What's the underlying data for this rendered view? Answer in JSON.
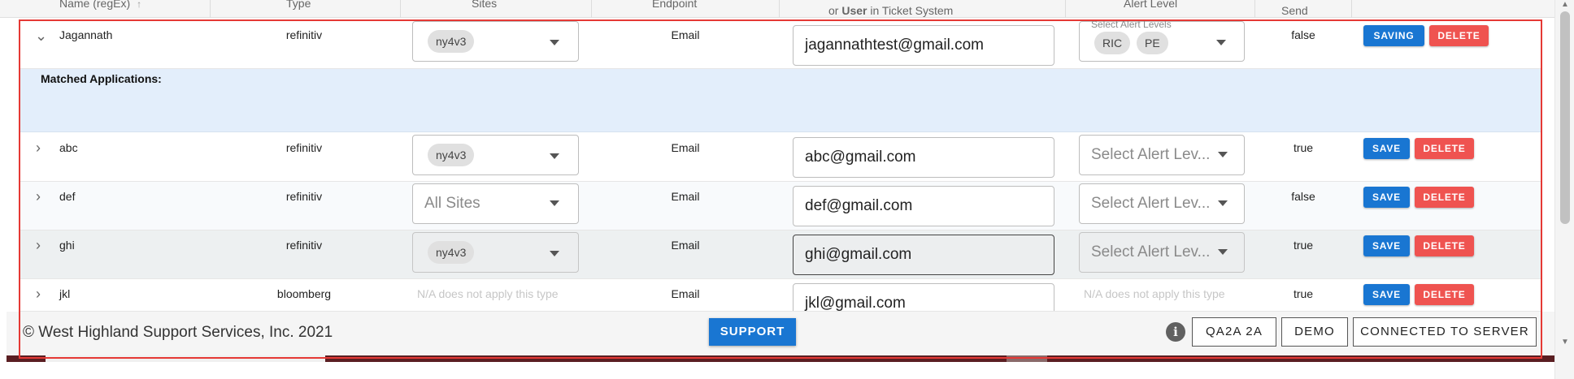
{
  "header": {
    "col_name": "Name (regEx)",
    "col_type": "Type",
    "col_sites": "Sites",
    "col_endpoint": "Endpoint",
    "col_email_line2_prefix": "or",
    "col_email_line2_bold": "User",
    "col_email_line2_suffix": "in Ticket System",
    "col_alert": "Alert Level",
    "col_send": "Send"
  },
  "rows": [
    {
      "name": "Jagannath",
      "type": "refinitiv",
      "site_chip": "ny4v3",
      "endpoint": "Email",
      "email": "jagannathtest@gmail.com",
      "alert_label": "Select Alert Levels",
      "alert_chips": [
        "RIC",
        "PE"
      ],
      "send": "false",
      "save_label": "SAVING",
      "delete_label": "DELETE"
    },
    {
      "name": "abc",
      "type": "refinitiv",
      "site_chip": "ny4v3",
      "endpoint": "Email",
      "email": "abc@gmail.com",
      "alert_placeholder": "Select Alert Lev...",
      "send": "true",
      "save_label": "SAVE",
      "delete_label": "DELETE"
    },
    {
      "name": "def",
      "type": "refinitiv",
      "sites_placeholder": "All Sites",
      "endpoint": "Email",
      "email": "def@gmail.com",
      "alert_placeholder": "Select Alert Lev...",
      "send": "false",
      "save_label": "SAVE",
      "delete_label": "DELETE"
    },
    {
      "name": "ghi",
      "type": "refinitiv",
      "site_chip": "ny4v3",
      "endpoint": "Email",
      "email": "ghi@gmail.com",
      "alert_placeholder": "Select Alert Lev...",
      "send": "true",
      "save_label": "SAVE",
      "delete_label": "DELETE"
    },
    {
      "name": "jkl",
      "type": "bloomberg",
      "sites_na": "N/A does not apply this type",
      "endpoint": "Email",
      "email": "jkl@gmail.com",
      "alert_na": "N/A does not apply this type",
      "send": "true",
      "save_label": "SAVE",
      "delete_label": "DELETE"
    }
  ],
  "matched": {
    "label": "Matched Applications:"
  },
  "footer": {
    "copyright": "© West Highland Support Services, Inc. 2021",
    "support": "SUPPORT",
    "env1": "QA2A 2A",
    "env2": "DEMO",
    "status": "CONNECTED TO SERVER"
  },
  "colors": {
    "primary": "#1976d2",
    "danger": "#ef5350",
    "highlight": "#e3eefb",
    "outline": "#e53935"
  },
  "icons": {
    "expanded": "chevron-down-icon",
    "collapsed": "chevron-right-icon",
    "sort": "arrow-up-icon",
    "info": "info-icon",
    "dropdown": "caret-down-icon"
  }
}
